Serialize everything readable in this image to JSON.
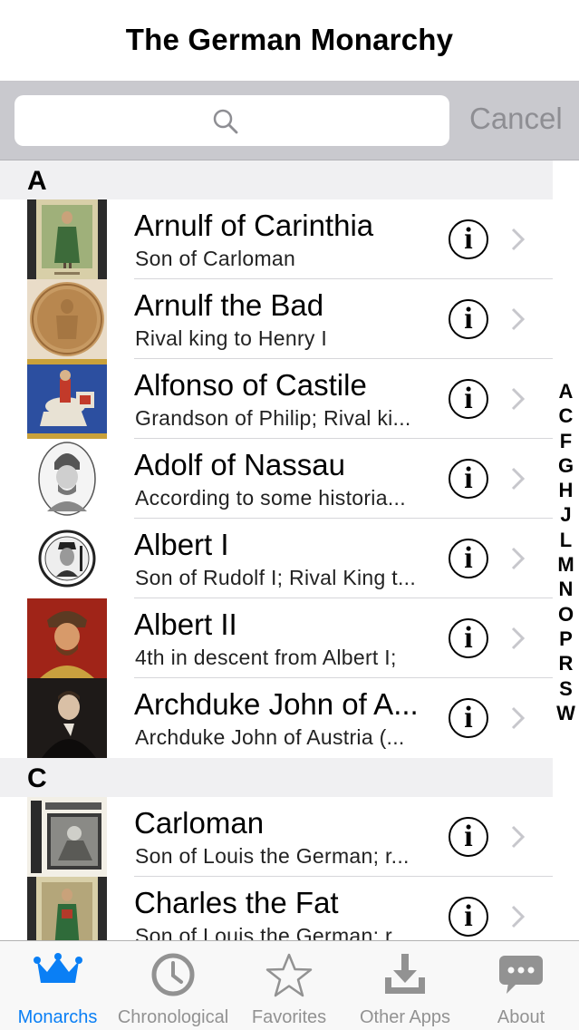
{
  "nav": {
    "title": "The German Monarchy"
  },
  "search": {
    "placeholder": "",
    "cancel_label": "Cancel"
  },
  "sections": [
    {
      "letter": "A",
      "rows": [
        {
          "name": "Arnulf of Carinthia",
          "subtitle": "Son of Carloman",
          "thumb": "figure-green"
        },
        {
          "name": "Arnulf the Bad",
          "subtitle": "Rival king to Henry I",
          "thumb": "wax-seal"
        },
        {
          "name": "Alfonso of Castile",
          "subtitle": "Grandson of Philip; Rival ki...",
          "thumb": "knight-blue"
        },
        {
          "name": "Adolf of Nassau",
          "subtitle": "According to some historia...",
          "thumb": "engraving-oval"
        },
        {
          "name": "Albert I",
          "subtitle": "Son of Rudolf I; Rival King t...",
          "thumb": "coin-portrait"
        },
        {
          "name": "Albert II",
          "subtitle": "4th in descent from Albert I;",
          "thumb": "portrait-red"
        },
        {
          "name": "Archduke John of A...",
          "subtitle": "Archduke John of Austria (...",
          "thumb": "portrait-dark"
        }
      ]
    },
    {
      "letter": "C",
      "rows": [
        {
          "name": "Carloman",
          "subtitle": "Son of Louis the German; r...",
          "thumb": "manuscript"
        },
        {
          "name": "Charles the Fat",
          "subtitle": "Son of Louis the German; r...",
          "thumb": "figure-green"
        }
      ]
    }
  ],
  "info_glyph": "i",
  "index_letters": [
    "A",
    "C",
    "F",
    "G",
    "H",
    "J",
    "L",
    "M",
    "N",
    "O",
    "P",
    "R",
    "S",
    "W"
  ],
  "tabs": [
    {
      "label": "Monarchs",
      "icon": "crown-icon",
      "active": true
    },
    {
      "label": "Chronological",
      "icon": "clock-icon",
      "active": false
    },
    {
      "label": "Favorites",
      "icon": "star-icon",
      "active": false
    },
    {
      "label": "Other Apps",
      "icon": "download-icon",
      "active": false
    },
    {
      "label": "About",
      "icon": "chat-bubble-icon",
      "active": false
    }
  ],
  "colors": {
    "accent": "#0a7ff5",
    "inactive": "#929292",
    "search_bar": "#c9c9ce",
    "section_header": "#f0f0f2"
  }
}
